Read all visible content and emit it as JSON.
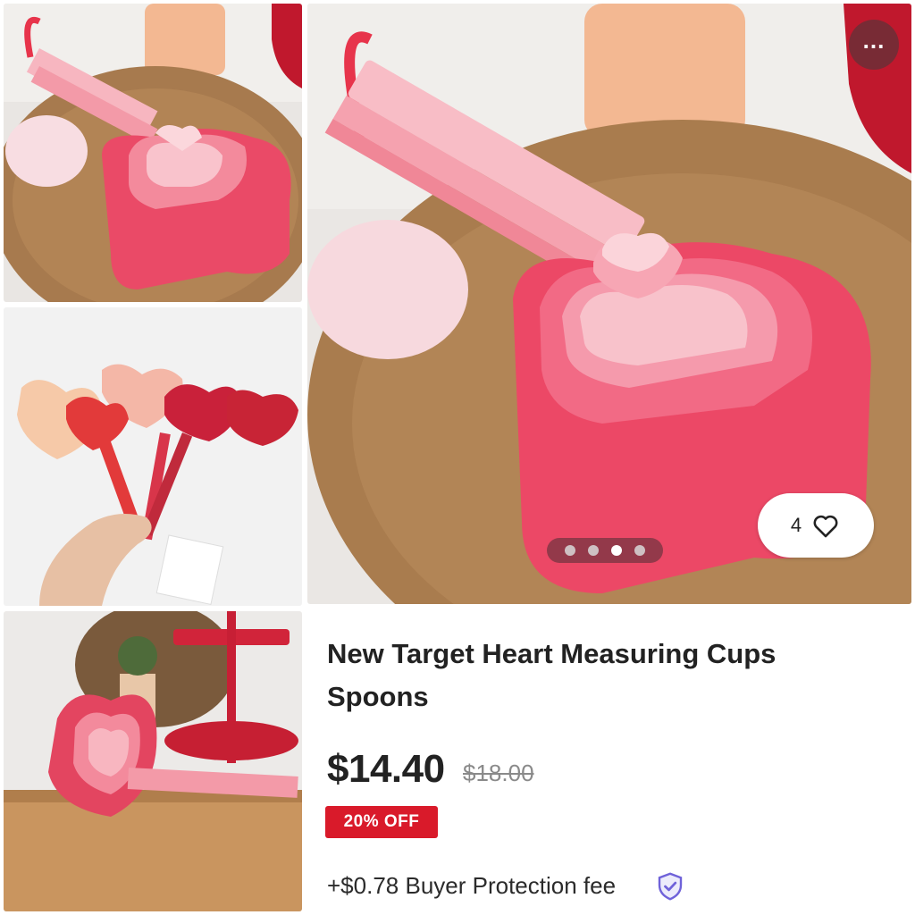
{
  "listing": {
    "title": "New Target Heart Measuring Cups Spoons",
    "price": "$14.40",
    "original_price": "$18.00",
    "discount_badge": "20% OFF",
    "fee_text": "+$0.78 Buyer Protection fee"
  },
  "gallery": {
    "like_count": "4",
    "more_label": "...",
    "image_count": 4,
    "active_image_index": 3
  },
  "icons": {
    "like": "heart-outline-icon",
    "more": "ellipsis-icon",
    "protection": "shield-check-icon"
  },
  "colors": {
    "discount_badge": "#d91a2a",
    "shield_icon": "#6f62d9"
  }
}
